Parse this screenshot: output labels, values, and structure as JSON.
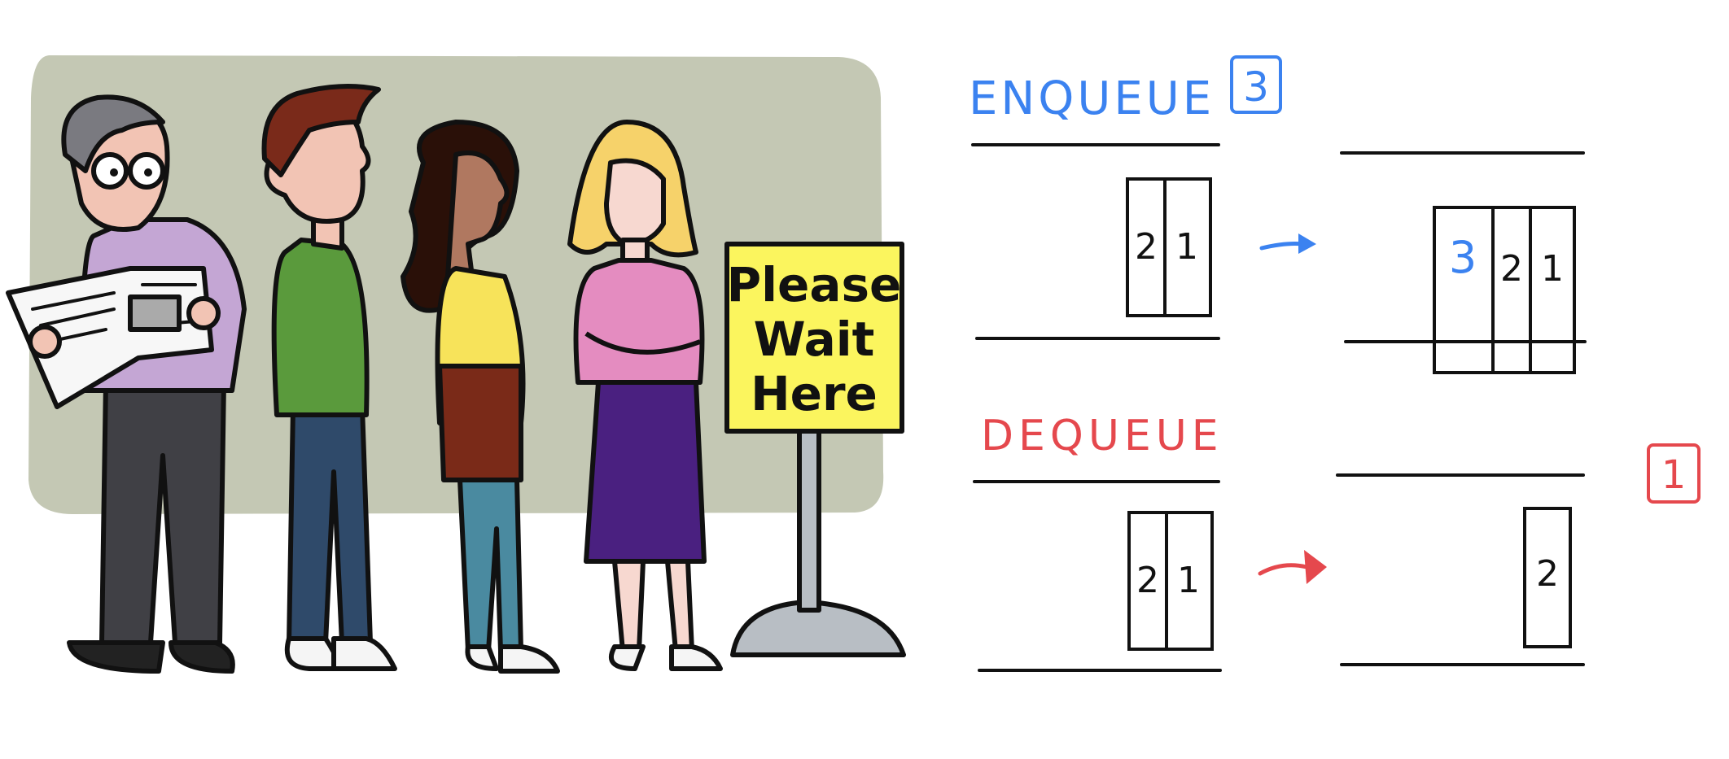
{
  "illustration": {
    "sign_lines": [
      "Please",
      "Wait",
      "Here"
    ],
    "colors": {
      "background": "#c4c8b4",
      "sign": "#fbf55e",
      "pole": "#b8bec4"
    }
  },
  "enqueue": {
    "title": "ENQUEUE",
    "value": "3",
    "color": "#3b82f0",
    "before": [
      "2",
      "1"
    ],
    "after_new": "3",
    "after": [
      "2",
      "1"
    ]
  },
  "dequeue": {
    "title": "DEQUEUE",
    "value": "1",
    "color": "#e5484d",
    "before": [
      "2",
      "1"
    ],
    "after": [
      "2"
    ]
  }
}
